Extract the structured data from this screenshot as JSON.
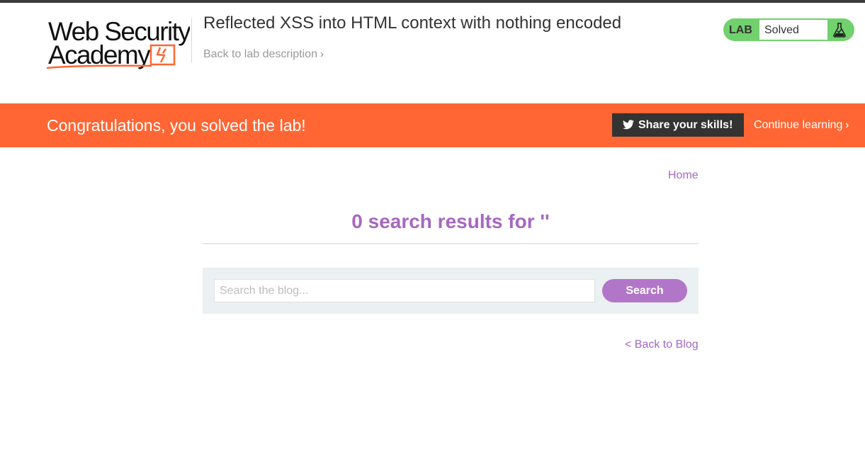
{
  "header": {
    "logo_line1": "Web Security",
    "logo_line2": "Academy",
    "lab_title": "Reflected XSS into HTML context with nothing encoded",
    "back_link": "Back to lab description",
    "back_link_icon": "double-chevron-right-icon",
    "lab_status": {
      "tag": "LAB",
      "status": "Solved",
      "icon": "flask-icon",
      "color": "#70d16d"
    }
  },
  "banner": {
    "message": "Congratulations, you solved the lab!",
    "share_button": "Share your skills!",
    "share_icon": "twitter-icon",
    "continue_link": "Continue learning",
    "color": "#ff6633"
  },
  "nav": {
    "home": "Home"
  },
  "search": {
    "results_heading": "0 search results for ''",
    "placeholder": "Search the blog...",
    "button": "Search"
  },
  "footer": {
    "back_to_blog": "< Back to Blog"
  },
  "colors": {
    "accent": "#a667c0",
    "button": "#b276c8",
    "panel": "#ebf0f2"
  }
}
